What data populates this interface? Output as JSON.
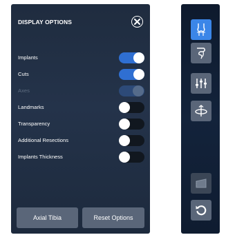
{
  "panel": {
    "title": "DISPLAY OPTIONS",
    "options": [
      {
        "label": "Implants",
        "state": "on",
        "enabled": true
      },
      {
        "label": "Cuts",
        "state": "on",
        "enabled": true
      },
      {
        "label": "Axes",
        "state": "on",
        "enabled": false
      },
      {
        "label": "Landmarks",
        "state": "off",
        "enabled": true
      },
      {
        "label": "Transparency",
        "state": "off",
        "enabled": true
      },
      {
        "label": "Additional Resections",
        "state": "off",
        "enabled": true
      },
      {
        "label": "Implants Thickness",
        "state": "off",
        "enabled": true
      }
    ],
    "buttons": {
      "axial": "Axial Tibia",
      "reset": "Reset Options"
    }
  },
  "toolbar": {
    "tools": [
      {
        "name": "femur-knee-icon",
        "active": true
      },
      {
        "name": "tibia-knee-icon",
        "active": false
      },
      {
        "name": "sliders-adjust-icon",
        "active": false
      },
      {
        "name": "rotate-3d-icon",
        "active": false
      },
      {
        "name": "resection-block-icon",
        "active": false,
        "faded": true
      },
      {
        "name": "undo-icon",
        "active": false
      }
    ]
  },
  "colors": {
    "accent": "#3b86e8",
    "toggle_on": "#2f6fd2",
    "panel_bg": "#24334a",
    "button_bg": "#5a6679"
  }
}
